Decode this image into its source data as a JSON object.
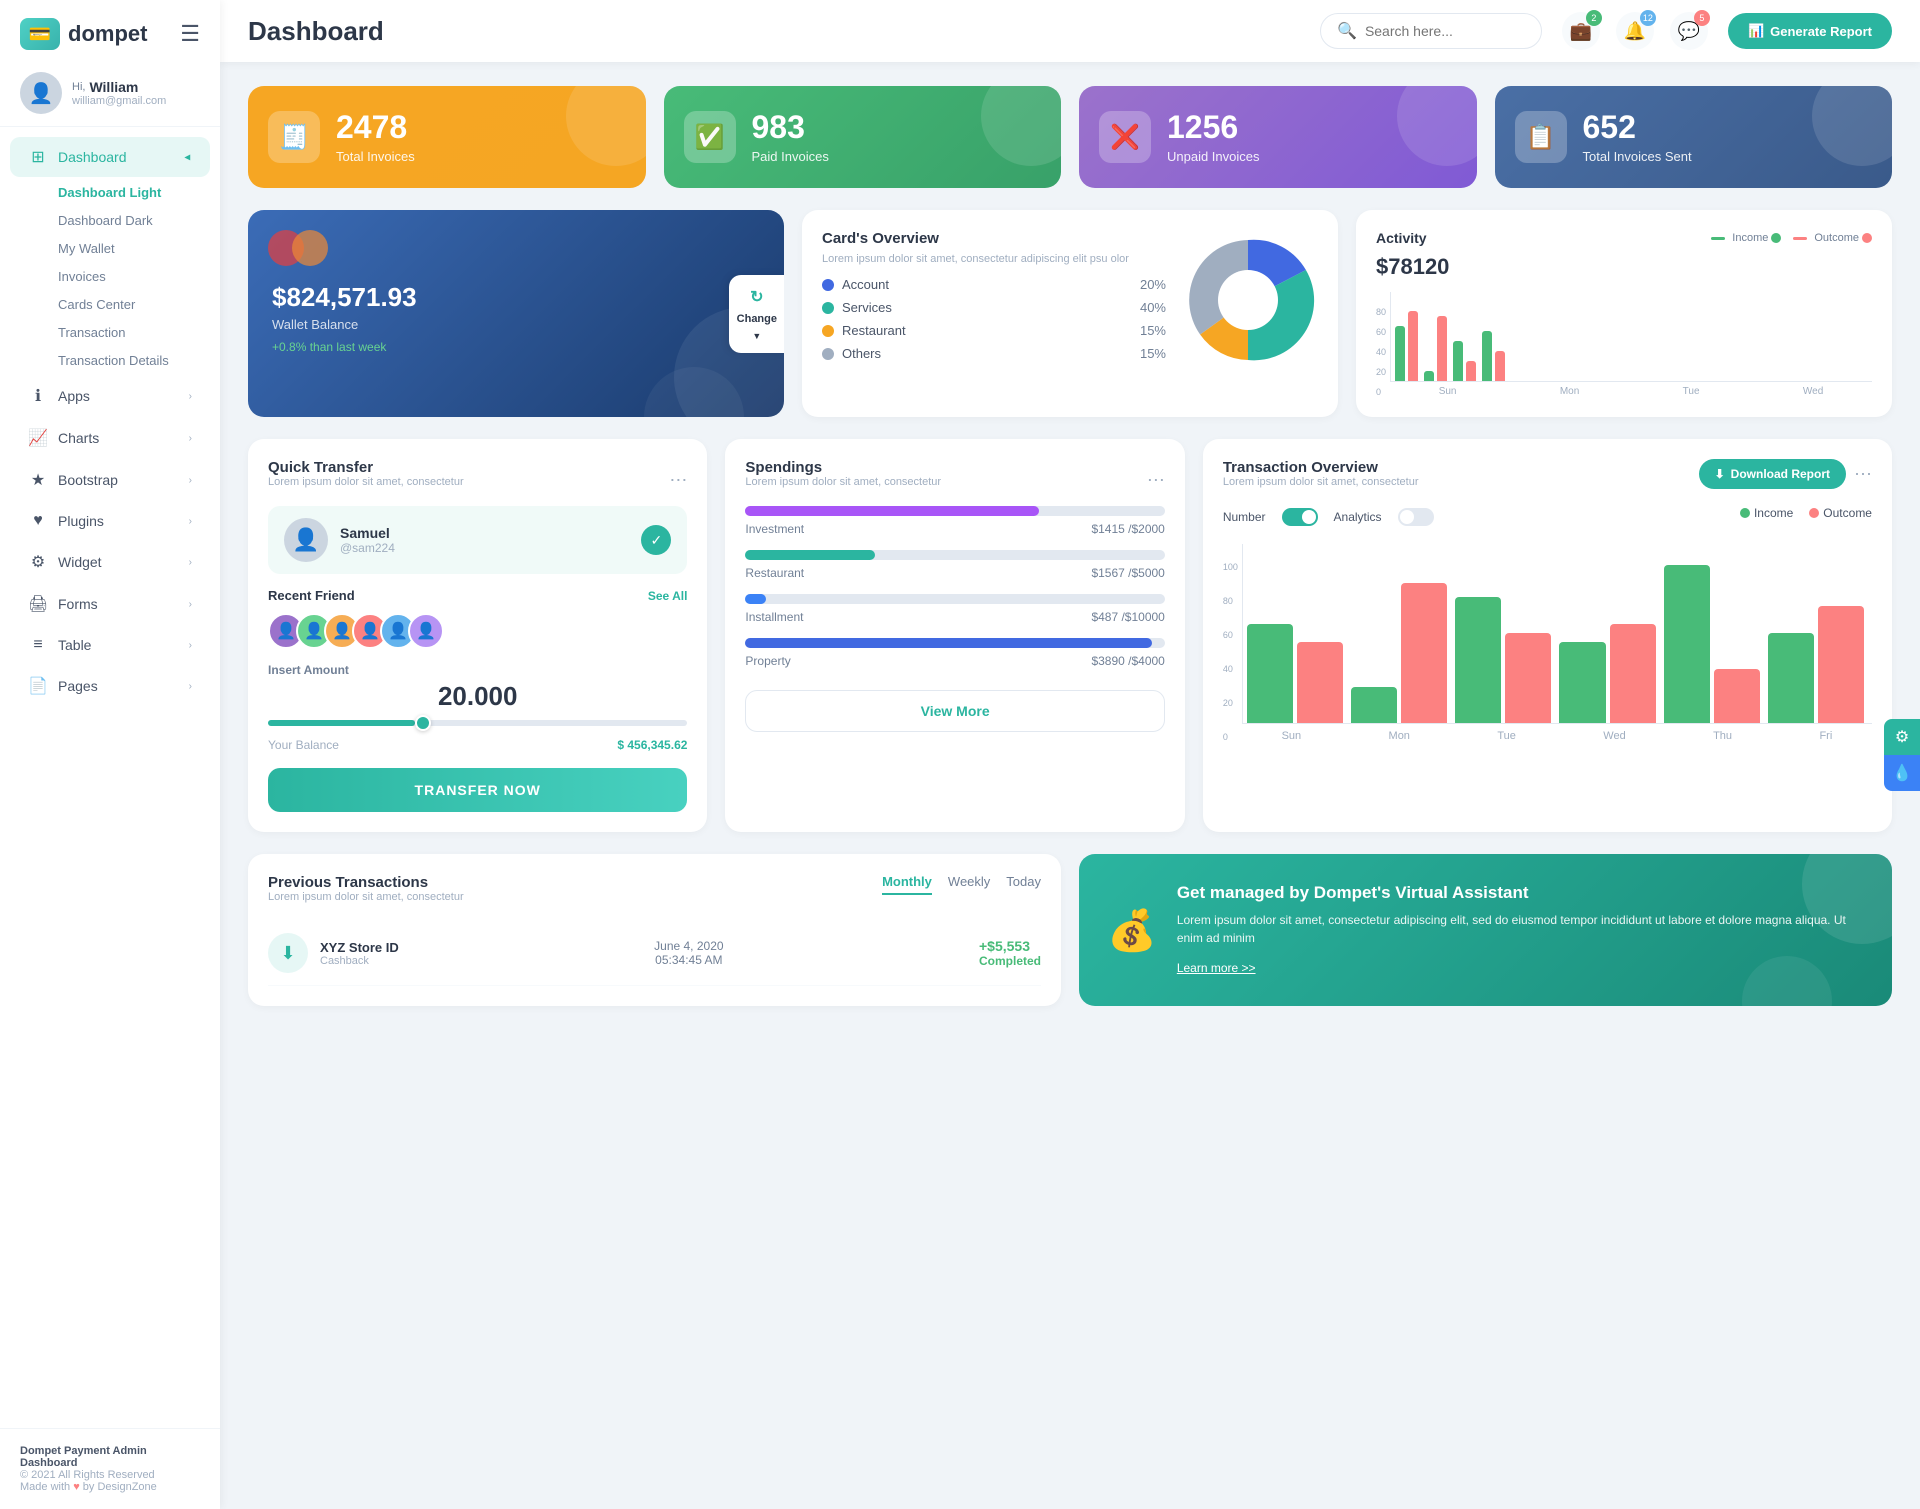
{
  "app": {
    "name": "dompet",
    "logo_icon": "💳"
  },
  "sidebar": {
    "user": {
      "greeting": "Hi,",
      "name": "William",
      "email": "william@gmail.com"
    },
    "nav": [
      {
        "id": "dashboard",
        "label": "Dashboard",
        "icon": "⊞",
        "active": true,
        "sub_items": [
          {
            "label": "Dashboard Light",
            "active": true
          },
          {
            "label": "Dashboard Dark",
            "active": false
          },
          {
            "label": "My Wallet",
            "active": false
          },
          {
            "label": "Invoices",
            "active": false
          },
          {
            "label": "Cards Center",
            "active": false
          },
          {
            "label": "Transaction",
            "active": false
          },
          {
            "label": "Transaction Details",
            "active": false
          }
        ]
      },
      {
        "id": "apps",
        "label": "Apps",
        "icon": "ℹ",
        "active": false
      },
      {
        "id": "charts",
        "label": "Charts",
        "icon": "📈",
        "active": false
      },
      {
        "id": "bootstrap",
        "label": "Bootstrap",
        "icon": "★",
        "active": false
      },
      {
        "id": "plugins",
        "label": "Plugins",
        "icon": "♥",
        "active": false
      },
      {
        "id": "widget",
        "label": "Widget",
        "icon": "⚙",
        "active": false
      },
      {
        "id": "forms",
        "label": "Forms",
        "icon": "🖨",
        "active": false
      },
      {
        "id": "table",
        "label": "Table",
        "icon": "≡",
        "active": false
      },
      {
        "id": "pages",
        "label": "Pages",
        "icon": "📄",
        "active": false
      }
    ],
    "footer": {
      "line1": "Dompet Payment Admin Dashboard",
      "line2": "© 2021 All Rights Reserved",
      "line3": "Made with ♥ by DesignZone"
    }
  },
  "topbar": {
    "title": "Dashboard",
    "search_placeholder": "Search here...",
    "badge_wallet": "2",
    "badge_notifications": "12",
    "badge_messages": "5",
    "generate_btn": "Generate Report"
  },
  "stat_cards": [
    {
      "id": "total-invoices",
      "number": "2478",
      "label": "Total Invoices",
      "icon": "🧾",
      "color": "orange"
    },
    {
      "id": "paid-invoices",
      "number": "983",
      "label": "Paid Invoices",
      "icon": "✅",
      "color": "green"
    },
    {
      "id": "unpaid-invoices",
      "number": "1256",
      "label": "Unpaid Invoices",
      "icon": "❌",
      "color": "purple"
    },
    {
      "id": "total-sent",
      "number": "652",
      "label": "Total Invoices Sent",
      "icon": "📋",
      "color": "slate"
    }
  ],
  "wallet": {
    "amount": "$824,571.93",
    "label": "Wallet Balance",
    "change": "+0.8% than last week",
    "change_btn": "Change"
  },
  "cards_overview": {
    "title": "Card's Overview",
    "description": "Lorem ipsum dolor sit amet, consectetur adipiscing elit psu olor",
    "items": [
      {
        "label": "Account",
        "pct": "20%",
        "color": "#4169e1"
      },
      {
        "label": "Services",
        "pct": "40%",
        "color": "#2bb5a0"
      },
      {
        "label": "Restaurant",
        "pct": "15%",
        "color": "#f6a623"
      },
      {
        "label": "Others",
        "pct": "15%",
        "color": "#a0aec0"
      }
    ]
  },
  "activity": {
    "title": "Activity",
    "amount": "$78120",
    "income_label": "Income",
    "outcome_label": "Outcome",
    "days": [
      "Sun",
      "Mon",
      "Tue",
      "Wed"
    ],
    "bars": [
      {
        "income": 55,
        "outcome": 70
      },
      {
        "income": 10,
        "outcome": 65
      },
      {
        "income": 40,
        "outcome": 20
      },
      {
        "income": 50,
        "outcome": 30
      }
    ],
    "y_axis": [
      "0",
      "20",
      "40",
      "60",
      "80"
    ]
  },
  "quick_transfer": {
    "title": "Quick Transfer",
    "subtitle": "Lorem ipsum dolor sit amet, consectetur",
    "contact_name": "Samuel",
    "contact_handle": "@sam224",
    "recent_label": "Recent Friend",
    "see_all": "See All",
    "amount_label": "Insert Amount",
    "amount": "20.000",
    "balance_label": "Your Balance",
    "balance_value": "$ 456,345.62",
    "transfer_btn": "TRANSFER NOW"
  },
  "spendings": {
    "title": "Spendings",
    "subtitle": "Lorem ipsum dolor sit amet, consectetur",
    "items": [
      {
        "label": "Investment",
        "current": "$1415",
        "max": "$2000",
        "pct": 70,
        "color": "#a855f7"
      },
      {
        "label": "Restaurant",
        "current": "$1567",
        "max": "$5000",
        "pct": 31,
        "color": "#2bb5a0"
      },
      {
        "label": "Installment",
        "current": "$487",
        "max": "$10000",
        "pct": 5,
        "color": "#3b82f6"
      },
      {
        "label": "Property",
        "current": "$3890",
        "max": "$4000",
        "pct": 97,
        "color": "#4169e1"
      }
    ],
    "view_more_btn": "View More"
  },
  "transaction_overview": {
    "title": "Transaction Overview",
    "subtitle": "Lorem ipsum dolor sit amet, consectetur",
    "download_btn": "Download Report",
    "toggle_number_label": "Number",
    "toggle_analytics_label": "Analytics",
    "income_label": "Income",
    "outcome_label": "Outcome",
    "days": [
      "Sun",
      "Mon",
      "Tue",
      "Wed",
      "Thu",
      "Fri"
    ],
    "bars": [
      {
        "income": 55,
        "outcome": 45
      },
      {
        "income": 20,
        "outcome": 78
      },
      {
        "income": 70,
        "outcome": 50
      },
      {
        "income": 45,
        "outcome": 55
      },
      {
        "income": 88,
        "outcome": 30
      },
      {
        "income": 50,
        "outcome": 65
      }
    ],
    "y_axis": [
      "0",
      "20",
      "40",
      "60",
      "80",
      "100"
    ]
  },
  "previous_transactions": {
    "title": "Previous Transactions",
    "subtitle": "Lorem ipsum dolor sit amet, consectetur",
    "tabs": [
      "Monthly",
      "Weekly",
      "Today"
    ],
    "active_tab": "Monthly",
    "items": [
      {
        "name": "XYZ Store ID",
        "type": "Cashback",
        "date": "June 4, 2020",
        "time": "05:34:45 AM",
        "amount": "+$5,553",
        "status": "Completed",
        "icon": "⬇"
      }
    ]
  },
  "virtual_assistant": {
    "title": "Get managed by Dompet's Virtual Assistant",
    "description": "Lorem ipsum dolor sit amet, consectetur adipiscing elit, sed do eiusmod tempor incididunt ut labore et dolore magna aliqua. Ut enim ad minim",
    "link": "Learn more >>"
  }
}
